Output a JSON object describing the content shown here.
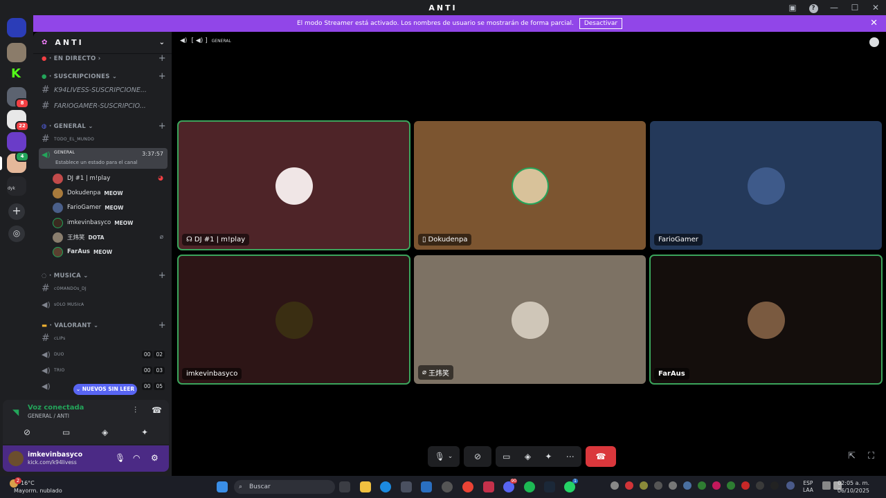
{
  "window": {
    "title": "ANTI"
  },
  "banner": {
    "text": "El modo Streamer está activado. Los nombres de usuario se mostrarán de forma parcial.",
    "button": "Desactivar"
  },
  "guilds": {
    "badge_8": "8",
    "badge_22": "22",
    "badge_4": "4",
    "dyk": "dyk"
  },
  "server": {
    "name": "ANTI"
  },
  "sidebar": {
    "cat_live": "EN DIRECTO",
    "cat_subs": "SUSCRIPCIONES",
    "chan_sub1": "K94LIVESS-SUSCRIPCIONE...",
    "chan_sub2": "FARIOGAMER-SUSCRIPCIO...",
    "cat_general": "GENERAL",
    "chan_todo": "TODO_EL_MUNDO",
    "chan_general": "GENERAL",
    "chan_general_timer": "3:37:57",
    "chan_general_status": "Establece un estado para el canal",
    "voice_users": [
      {
        "name": "DJ #1 | m!play",
        "tag": ""
      },
      {
        "name": "Dokudenpa",
        "tag": "MEOW"
      },
      {
        "name": "FarioGamer",
        "tag": "MEOW"
      },
      {
        "name": "imkevinbasyco",
        "tag": "MEOW"
      },
      {
        "name": "王炜笑",
        "tag": "DOTA"
      },
      {
        "name": "FarAus",
        "tag": "MEOW"
      }
    ],
    "cat_musica": "MUSICA",
    "chan_comandos": "cOMANDOs_DJ",
    "chan_solo": "sOLO MUSIcA",
    "cat_valorant": "VALORANT",
    "chan_clips": "cLIPs",
    "chan_duo": "DUO",
    "chan_duo_counts": [
      "00",
      "02"
    ],
    "chan_trio": "TRIO",
    "chan_trio_counts": [
      "00",
      "03"
    ],
    "chan_next_counts": [
      "00",
      "05"
    ],
    "new_unread": "NUEVOS SIN LEER"
  },
  "voice_panel": {
    "status": "Voz conectada",
    "channel": "GENERAL / ANTI"
  },
  "user_panel": {
    "name": "imkevinbasyco",
    "status": "kick.com/k94livess"
  },
  "main": {
    "header": "GENERAL",
    "tiles": [
      {
        "label": "DJ #1 | m!play",
        "bg": "#4e2428"
      },
      {
        "label": "Dokudenpa",
        "bg": "#7c5530"
      },
      {
        "label": "FarioGamer",
        "bg": "#24395a"
      },
      {
        "label": "imkevinbasyco",
        "bg": "#2d1516"
      },
      {
        "label": "王炜笑",
        "bg": "#7d7264"
      },
      {
        "label": "FarAus",
        "bg": "#140e0c"
      }
    ]
  },
  "taskbar": {
    "temp": "16°C",
    "weather": "Mayorm. nublado",
    "search": "Buscar",
    "lang": "ESP",
    "lang2": "LAA",
    "time": "02:05 a. m.",
    "date": "06/10/2025",
    "weather_badge": "2",
    "discord_badge": "90",
    "whatsapp_badge": "1"
  }
}
